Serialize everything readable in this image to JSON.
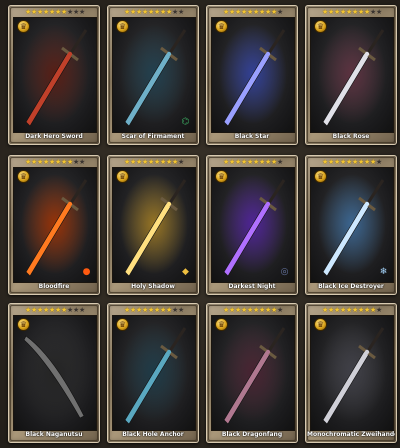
{
  "cards": [
    {
      "name": "Dark Hero Sword",
      "stars": 7,
      "blade": "#c0402a",
      "glow": "#5a1a10",
      "element": "",
      "elementIcon": "",
      "elementColor": ""
    },
    {
      "name": "Scar of Firmament",
      "stars": 8,
      "blade": "#6fb0c8",
      "glow": "#1e4050",
      "element": "wind-icon",
      "elementIcon": "⌬",
      "elementColor": "#3ca860"
    },
    {
      "name": "Black Star",
      "stars": 9,
      "blade": "#9aa0ff",
      "glow": "#3040a0",
      "element": "",
      "elementIcon": "",
      "elementColor": ""
    },
    {
      "name": "Black Rose",
      "stars": 8,
      "blade": "#e0e0e8",
      "glow": "#603040",
      "element": "",
      "elementIcon": "",
      "elementColor": ""
    },
    {
      "name": "Bloodfire",
      "stars": 8,
      "blade": "#ff7a20",
      "glow": "#a03000",
      "element": "fire-icon",
      "elementIcon": "●",
      "elementColor": "#ff5a10"
    },
    {
      "name": "Holy Shadow",
      "stars": 9,
      "blade": "#ffe080",
      "glow": "#a07a20",
      "element": "light-icon",
      "elementIcon": "◆",
      "elementColor": "#f0c040"
    },
    {
      "name": "Darkest Night",
      "stars": 9,
      "blade": "#b070ff",
      "glow": "#5020a0",
      "element": "void-icon",
      "elementIcon": "◎",
      "elementColor": "#6a7aa8"
    },
    {
      "name": "Black Ice Destroyer",
      "stars": 9,
      "blade": "#cde8ff",
      "glow": "#3a6a9a",
      "element": "ice-icon",
      "elementIcon": "❄",
      "elementColor": "#a8d8ff"
    },
    {
      "name": "Black Naganutsu",
      "stars": 7,
      "blade": "#707070",
      "glow": "#202020",
      "element": "",
      "elementIcon": "",
      "elementColor": ""
    },
    {
      "name": "Black Hole Anchor",
      "stars": 8,
      "blade": "#5aa8c0",
      "glow": "#1a3a48",
      "element": "",
      "elementIcon": "",
      "elementColor": ""
    },
    {
      "name": "Black Dragonfang",
      "stars": 9,
      "blade": "#b07890",
      "glow": "#4a2030",
      "element": "",
      "elementIcon": "",
      "elementColor": ""
    },
    {
      "name": "Monochromatic Zweihander",
      "stars": 9,
      "blade": "#d0d0d8",
      "glow": "#404048",
      "element": "",
      "elementIcon": "",
      "elementColor": ""
    }
  ],
  "maxStars": 10
}
